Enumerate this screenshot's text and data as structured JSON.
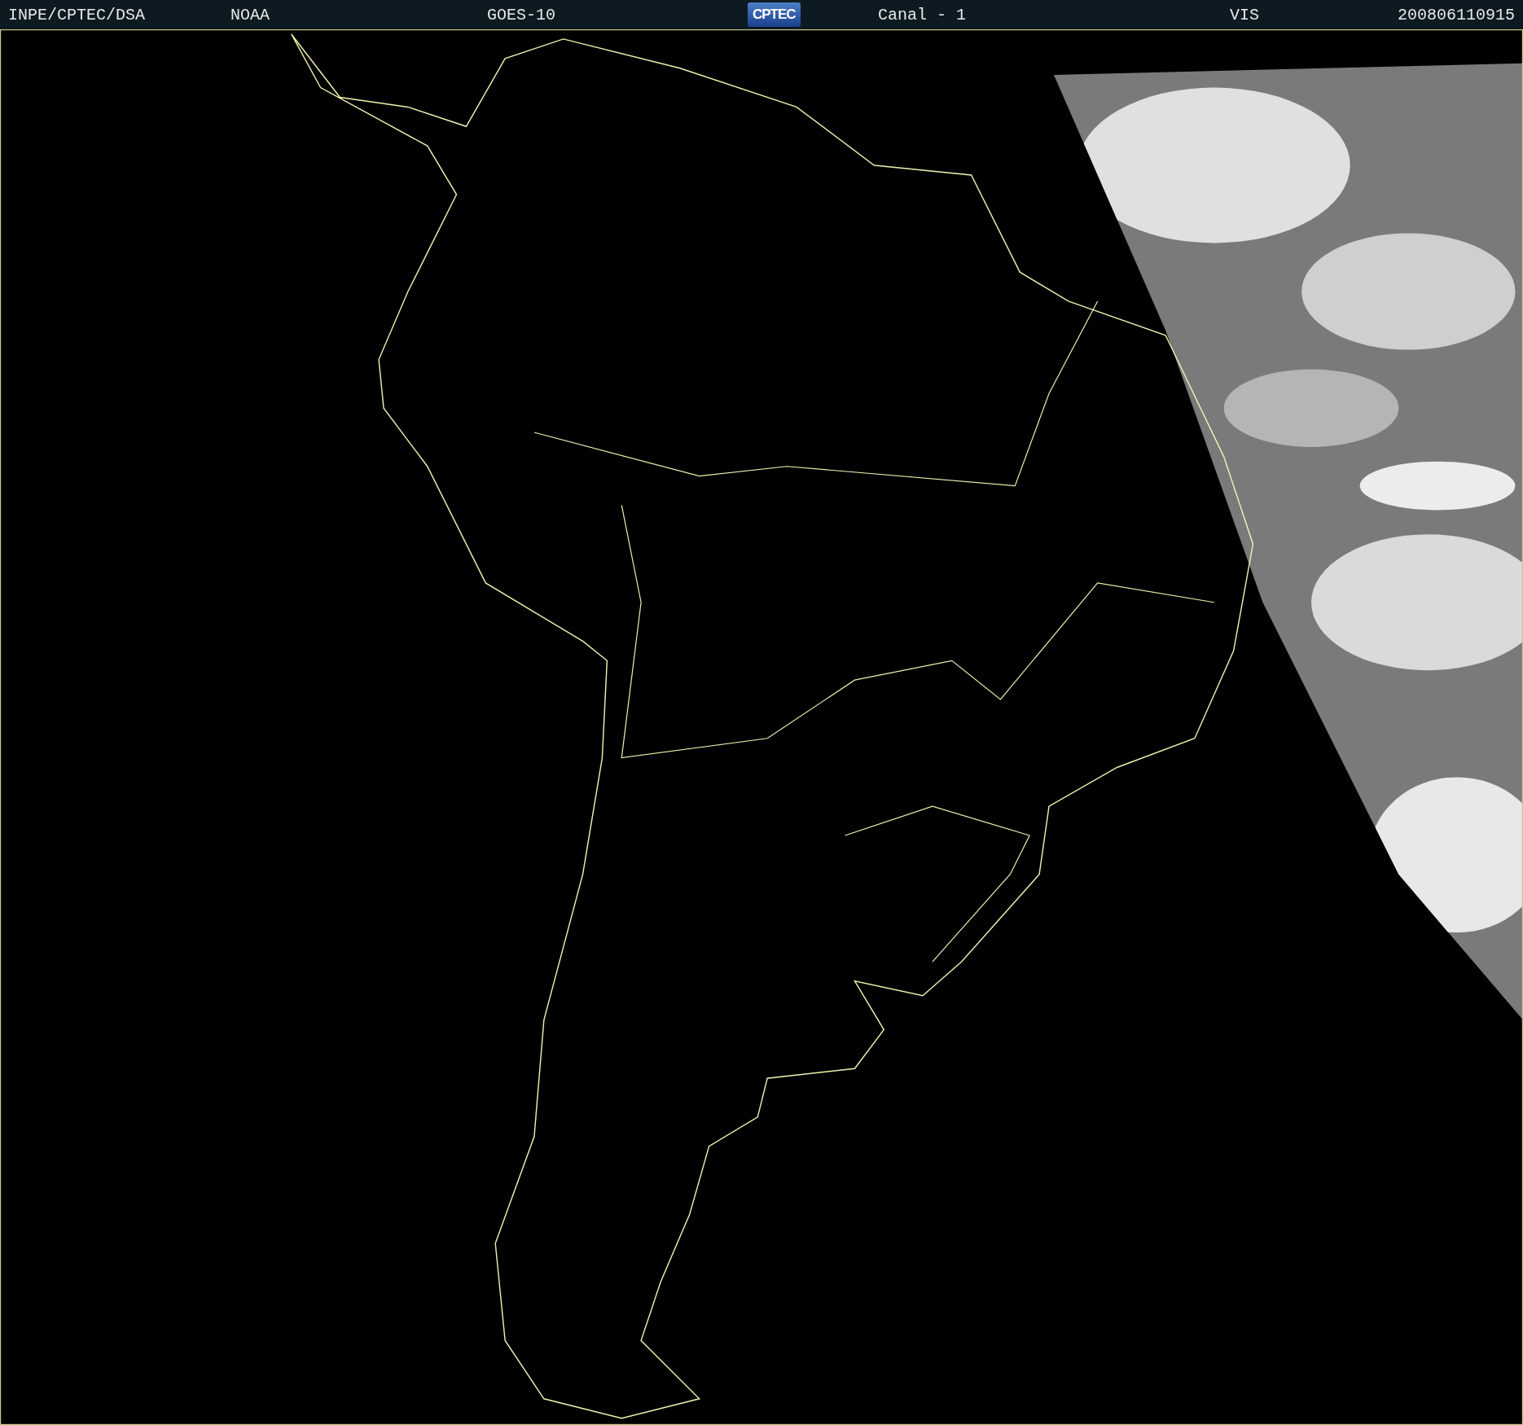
{
  "header": {
    "items": [
      {
        "kind": "text",
        "text": "INPE/CPTEC/DSA"
      },
      {
        "kind": "text",
        "text": "NOAA"
      },
      {
        "kind": "text",
        "text": "GOES-10"
      },
      {
        "kind": "logo",
        "text": "CPTEC"
      },
      {
        "kind": "text",
        "text": "Canal - 1"
      },
      {
        "kind": "text",
        "text": "VIS"
      },
      {
        "kind": "text",
        "text": "200806110915"
      }
    ]
  }
}
